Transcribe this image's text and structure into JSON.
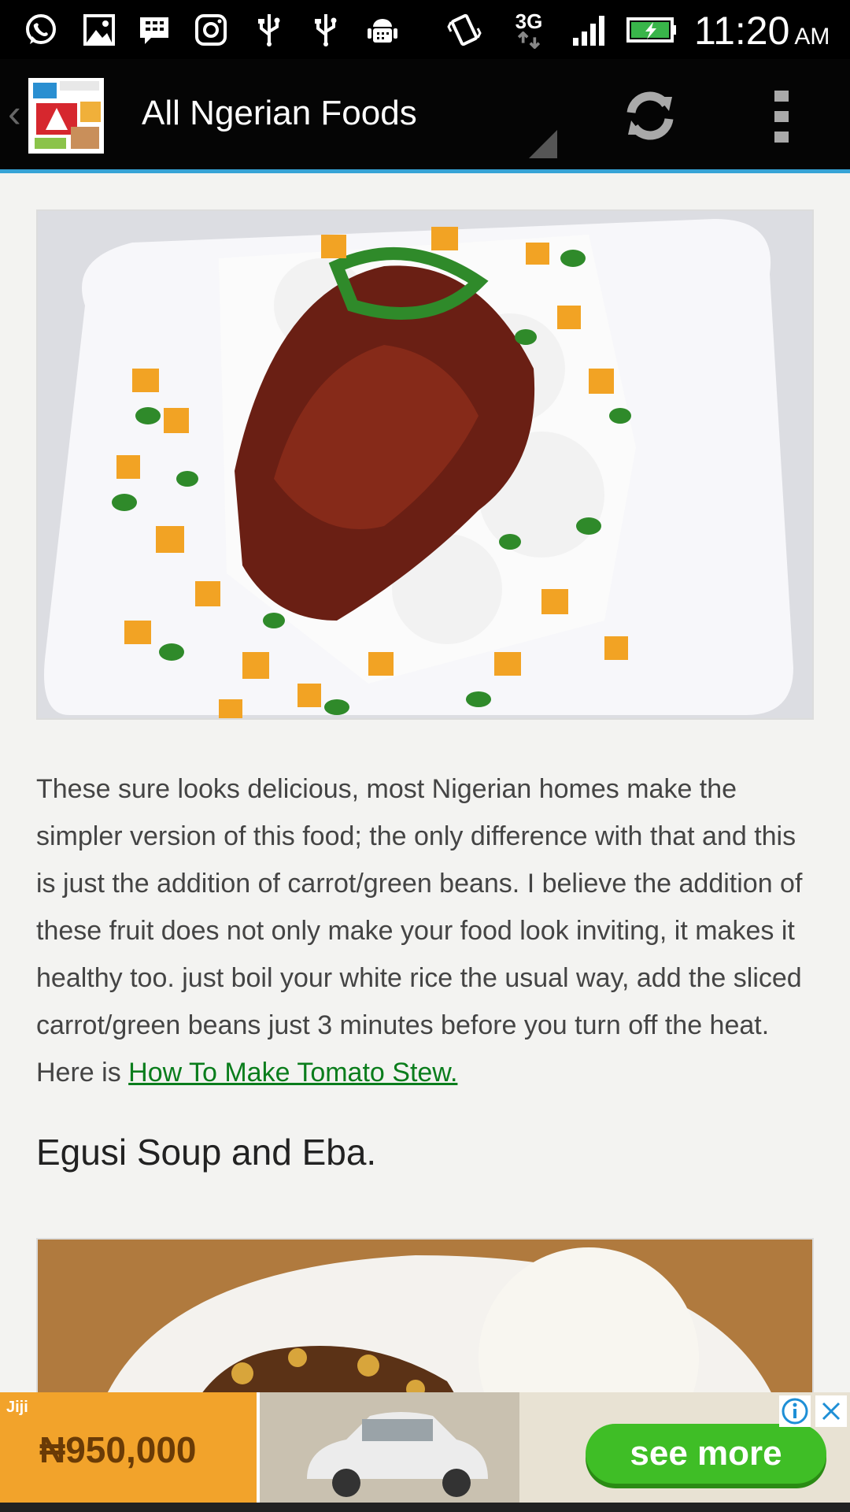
{
  "status_bar": {
    "icons": [
      "whatsapp-icon",
      "gallery-icon",
      "bbm-icon",
      "instagram-icon",
      "usb-icon",
      "usb-icon",
      "android-debug-icon",
      "vibrate-icon",
      "network-3g-icon",
      "signal-icon",
      "battery-charging-icon"
    ],
    "network": "3G",
    "time": "11:20",
    "ampm": "AM"
  },
  "action_bar": {
    "title": "All Ngerian Foods",
    "icons": [
      "app-logo",
      "refresh-icon",
      "overflow-menu-icon"
    ]
  },
  "article": {
    "paragraph": "These sure looks delicious, most Nigerian homes make the simpler version of this food; the only difference with that and this is just the addition of carrot/green beans. I believe the addition of these fruit does not only make your food look inviting, it makes it healthy too. just boil your white rice the usual way, add the sliced carrot/green beans just 3 minutes before you turn off the heat. Here is ",
    "link_text": "How To Make Tomato Stew.",
    "heading": "Egusi Soup and Eba."
  },
  "ad": {
    "brand": "Jiji",
    "price": "₦950,000",
    "cta": "see more",
    "icons": [
      "ad-info-icon",
      "ad-close-icon"
    ]
  },
  "colors": {
    "accent": "#36a3d6",
    "link": "#0a7d1c",
    "ad_orange": "#f2a32b",
    "ad_green": "#3fbe26"
  }
}
